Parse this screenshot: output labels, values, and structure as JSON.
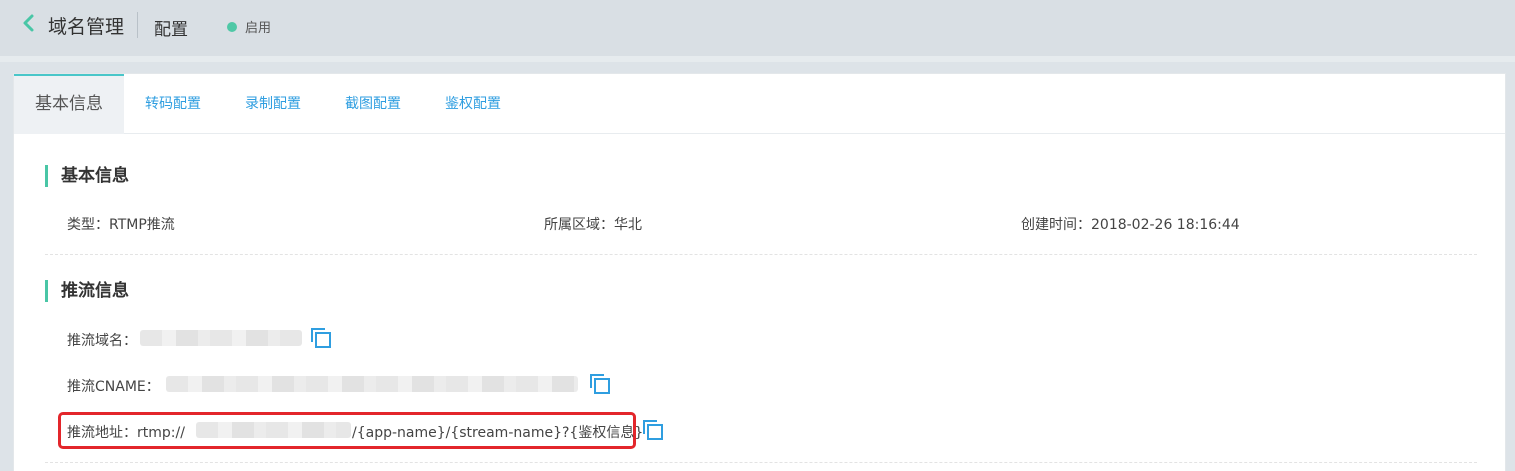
{
  "header": {
    "back_icon": "chevron-left-icon",
    "title": "域名管理",
    "subtitle": "配置",
    "status": "启用",
    "status_color": "#4fc8a6"
  },
  "tabs": [
    {
      "label": "基本信息",
      "active": true
    },
    {
      "label": "转码配置",
      "active": false
    },
    {
      "label": "录制配置",
      "active": false
    },
    {
      "label": "截图配置",
      "active": false
    },
    {
      "label": "鉴权配置",
      "active": false
    }
  ],
  "basic_info": {
    "title": "基本信息",
    "type": "类型：RTMP推流",
    "region": "所属区域：华北",
    "created": "创建时间：2018-02-26 18:16:44"
  },
  "push_info": {
    "title": "推流信息",
    "domain_label": "推流域名：",
    "cname_label": "推流CNAME：",
    "address_prefix": "推流地址：rtmp://",
    "address_suffix": "/{app-name}/{stream-name}?{鉴权信息}",
    "copy_icon": "copy-icon"
  },
  "colors": {
    "accent": "#49c6a6",
    "link": "#2f9ee0",
    "highlight": "#e3262b"
  }
}
